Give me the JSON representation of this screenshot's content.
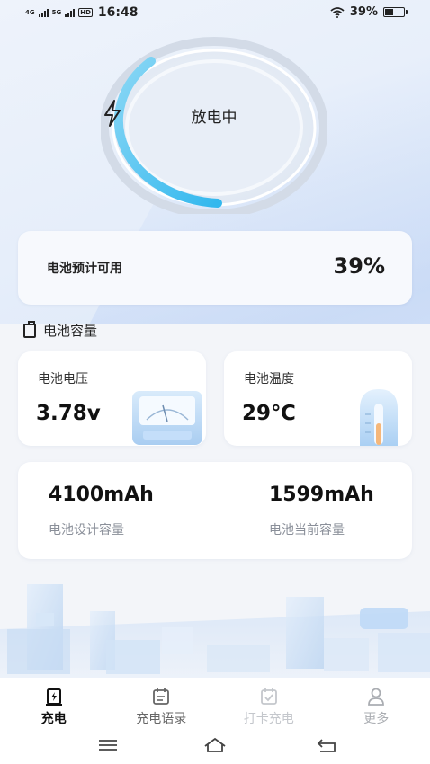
{
  "status_bar": {
    "signal1": "4G",
    "signal2": "5G",
    "hd": "HD",
    "time": "16:48",
    "battery_percent": "39%",
    "battery_level": 0.39
  },
  "gauge": {
    "status": "放电中",
    "icon": "lightning-icon",
    "colors": {
      "arc": "#4fc6f0",
      "ring": "#d6dde8"
    }
  },
  "estimate": {
    "label": "电池预计可用",
    "value": "39%"
  },
  "section": {
    "title": "电池容量",
    "icon": "battery-outline-icon"
  },
  "voltage": {
    "label": "电池电压",
    "value": "3.78v",
    "icon": "voltmeter-icon"
  },
  "temperature": {
    "label": "电池温度",
    "value": "29℃",
    "icon": "thermometer-icon"
  },
  "capacity": {
    "design_value": "4100mAh",
    "design_label": "电池设计容量",
    "current_value": "1599mAh",
    "current_label": "电池当前容量"
  },
  "tabs": [
    {
      "label": "充电",
      "icon": "charge-icon",
      "active": true
    },
    {
      "label": "充电语录",
      "icon": "calendar-icon"
    },
    {
      "label": "打卡充电",
      "icon": "check-calendar-icon"
    },
    {
      "label": "更多",
      "icon": "user-icon"
    }
  ],
  "nav": {
    "menu": "menu-icon",
    "home": "home-icon",
    "back": "back-icon"
  }
}
